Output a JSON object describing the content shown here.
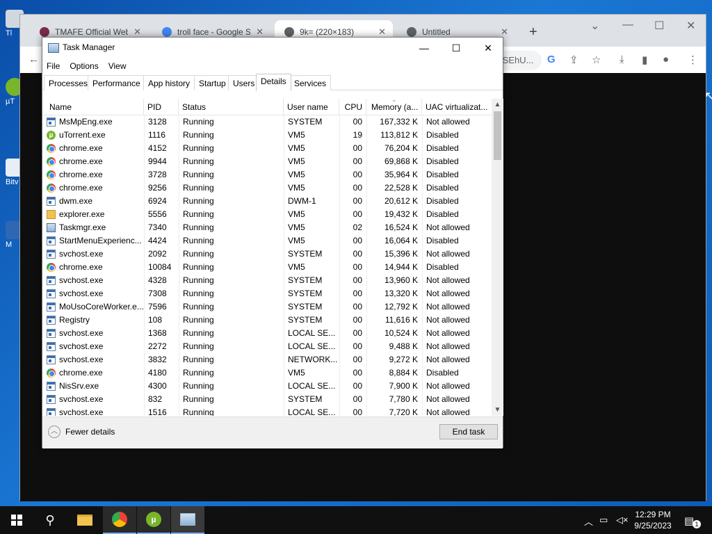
{
  "desktop": {
    "icons": [
      {
        "label": "Tl"
      },
      {
        "label": "µT"
      },
      {
        "label": "Bitv C"
      },
      {
        "label": "M"
      }
    ]
  },
  "chrome": {
    "tabs": [
      {
        "title": "TMAFE Official Website",
        "active": false,
        "favicon_color": "#7a2b4e"
      },
      {
        "title": "troll face - Google Search",
        "active": false,
        "favicon_color": "#4285f4"
      },
      {
        "title": "9k= (220×183)",
        "active": true,
        "favicon_color": "#5f6368"
      },
      {
        "title": "Untitled",
        "active": false,
        "favicon_color": "#5f6368"
      }
    ],
    "new_tab_label": "+",
    "omnibox_tail": "ISEhU..."
  },
  "taskmgr": {
    "title": "Task Manager",
    "menu": [
      "File",
      "Options",
      "View"
    ],
    "tabs": [
      {
        "label": "Processes",
        "active": false
      },
      {
        "label": "Performance",
        "active": false
      },
      {
        "label": "App history",
        "active": false
      },
      {
        "label": "Startup",
        "active": false
      },
      {
        "label": "Users",
        "active": false
      },
      {
        "label": "Details",
        "active": true
      },
      {
        "label": "Services",
        "active": false
      }
    ],
    "columns": [
      "Name",
      "PID",
      "Status",
      "User name",
      "CPU",
      "Memory (a...",
      "UAC virtualizat..."
    ],
    "rows": [
      {
        "icon": "generic",
        "name": "MsMpEng.exe",
        "pid": "3128",
        "status": "Running",
        "user": "SYSTEM",
        "cpu": "00",
        "memory": "167,332 K",
        "uac": "Not allowed"
      },
      {
        "icon": "utorrent",
        "name": "uTorrent.exe",
        "pid": "1116",
        "status": "Running",
        "user": "VM5",
        "cpu": "19",
        "memory": "113,812 K",
        "uac": "Disabled"
      },
      {
        "icon": "chrome",
        "name": "chrome.exe",
        "pid": "4152",
        "status": "Running",
        "user": "VM5",
        "cpu": "00",
        "memory": "76,204 K",
        "uac": "Disabled"
      },
      {
        "icon": "chrome",
        "name": "chrome.exe",
        "pid": "9944",
        "status": "Running",
        "user": "VM5",
        "cpu": "00",
        "memory": "69,868 K",
        "uac": "Disabled"
      },
      {
        "icon": "chrome",
        "name": "chrome.exe",
        "pid": "3728",
        "status": "Running",
        "user": "VM5",
        "cpu": "00",
        "memory": "35,964 K",
        "uac": "Disabled"
      },
      {
        "icon": "chrome",
        "name": "chrome.exe",
        "pid": "9256",
        "status": "Running",
        "user": "VM5",
        "cpu": "00",
        "memory": "22,528 K",
        "uac": "Disabled"
      },
      {
        "icon": "generic",
        "name": "dwm.exe",
        "pid": "6924",
        "status": "Running",
        "user": "DWM-1",
        "cpu": "00",
        "memory": "20,612 K",
        "uac": "Disabled"
      },
      {
        "icon": "explorer",
        "name": "explorer.exe",
        "pid": "5556",
        "status": "Running",
        "user": "VM5",
        "cpu": "00",
        "memory": "19,432 K",
        "uac": "Disabled"
      },
      {
        "icon": "taskmgr",
        "name": "Taskmgr.exe",
        "pid": "7340",
        "status": "Running",
        "user": "VM5",
        "cpu": "02",
        "memory": "16,524 K",
        "uac": "Not allowed"
      },
      {
        "icon": "generic",
        "name": "StartMenuExperienc...",
        "pid": "4424",
        "status": "Running",
        "user": "VM5",
        "cpu": "00",
        "memory": "16,064 K",
        "uac": "Disabled"
      },
      {
        "icon": "generic",
        "name": "svchost.exe",
        "pid": "2092",
        "status": "Running",
        "user": "SYSTEM",
        "cpu": "00",
        "memory": "15,396 K",
        "uac": "Not allowed"
      },
      {
        "icon": "chrome",
        "name": "chrome.exe",
        "pid": "10084",
        "status": "Running",
        "user": "VM5",
        "cpu": "00",
        "memory": "14,944 K",
        "uac": "Disabled"
      },
      {
        "icon": "generic",
        "name": "svchost.exe",
        "pid": "4328",
        "status": "Running",
        "user": "SYSTEM",
        "cpu": "00",
        "memory": "13,960 K",
        "uac": "Not allowed"
      },
      {
        "icon": "generic",
        "name": "svchost.exe",
        "pid": "7308",
        "status": "Running",
        "user": "SYSTEM",
        "cpu": "00",
        "memory": "13,320 K",
        "uac": "Not allowed"
      },
      {
        "icon": "generic",
        "name": "MoUsoCoreWorker.e...",
        "pid": "7596",
        "status": "Running",
        "user": "SYSTEM",
        "cpu": "00",
        "memory": "12,792 K",
        "uac": "Not allowed"
      },
      {
        "icon": "generic",
        "name": "Registry",
        "pid": "108",
        "status": "Running",
        "user": "SYSTEM",
        "cpu": "00",
        "memory": "11,616 K",
        "uac": "Not allowed"
      },
      {
        "icon": "generic",
        "name": "svchost.exe",
        "pid": "1368",
        "status": "Running",
        "user": "LOCAL SE...",
        "cpu": "00",
        "memory": "10,524 K",
        "uac": "Not allowed"
      },
      {
        "icon": "generic",
        "name": "svchost.exe",
        "pid": "2272",
        "status": "Running",
        "user": "LOCAL SE...",
        "cpu": "00",
        "memory": "9,488 K",
        "uac": "Not allowed"
      },
      {
        "icon": "generic",
        "name": "svchost.exe",
        "pid": "3832",
        "status": "Running",
        "user": "NETWORK...",
        "cpu": "00",
        "memory": "9,272 K",
        "uac": "Not allowed"
      },
      {
        "icon": "chrome",
        "name": "chrome.exe",
        "pid": "4180",
        "status": "Running",
        "user": "VM5",
        "cpu": "00",
        "memory": "8,884 K",
        "uac": "Disabled"
      },
      {
        "icon": "generic",
        "name": "NisSrv.exe",
        "pid": "4300",
        "status": "Running",
        "user": "LOCAL SE...",
        "cpu": "00",
        "memory": "7,900 K",
        "uac": "Not allowed"
      },
      {
        "icon": "generic",
        "name": "svchost.exe",
        "pid": "832",
        "status": "Running",
        "user": "SYSTEM",
        "cpu": "00",
        "memory": "7,780 K",
        "uac": "Not allowed"
      },
      {
        "icon": "generic",
        "name": "svchost.exe",
        "pid": "1516",
        "status": "Running",
        "user": "LOCAL SE...",
        "cpu": "00",
        "memory": "7,720 K",
        "uac": "Not allowed"
      }
    ],
    "footer": {
      "fewer_details_label": "Fewer details",
      "end_task_label": "End task"
    }
  },
  "taskbar": {
    "apps": [
      "start",
      "search",
      "file-explorer",
      "chrome",
      "utorrent",
      "task-manager"
    ],
    "clock_time": "12:29 PM",
    "clock_date": "9/25/2023",
    "notification_count": "1"
  }
}
